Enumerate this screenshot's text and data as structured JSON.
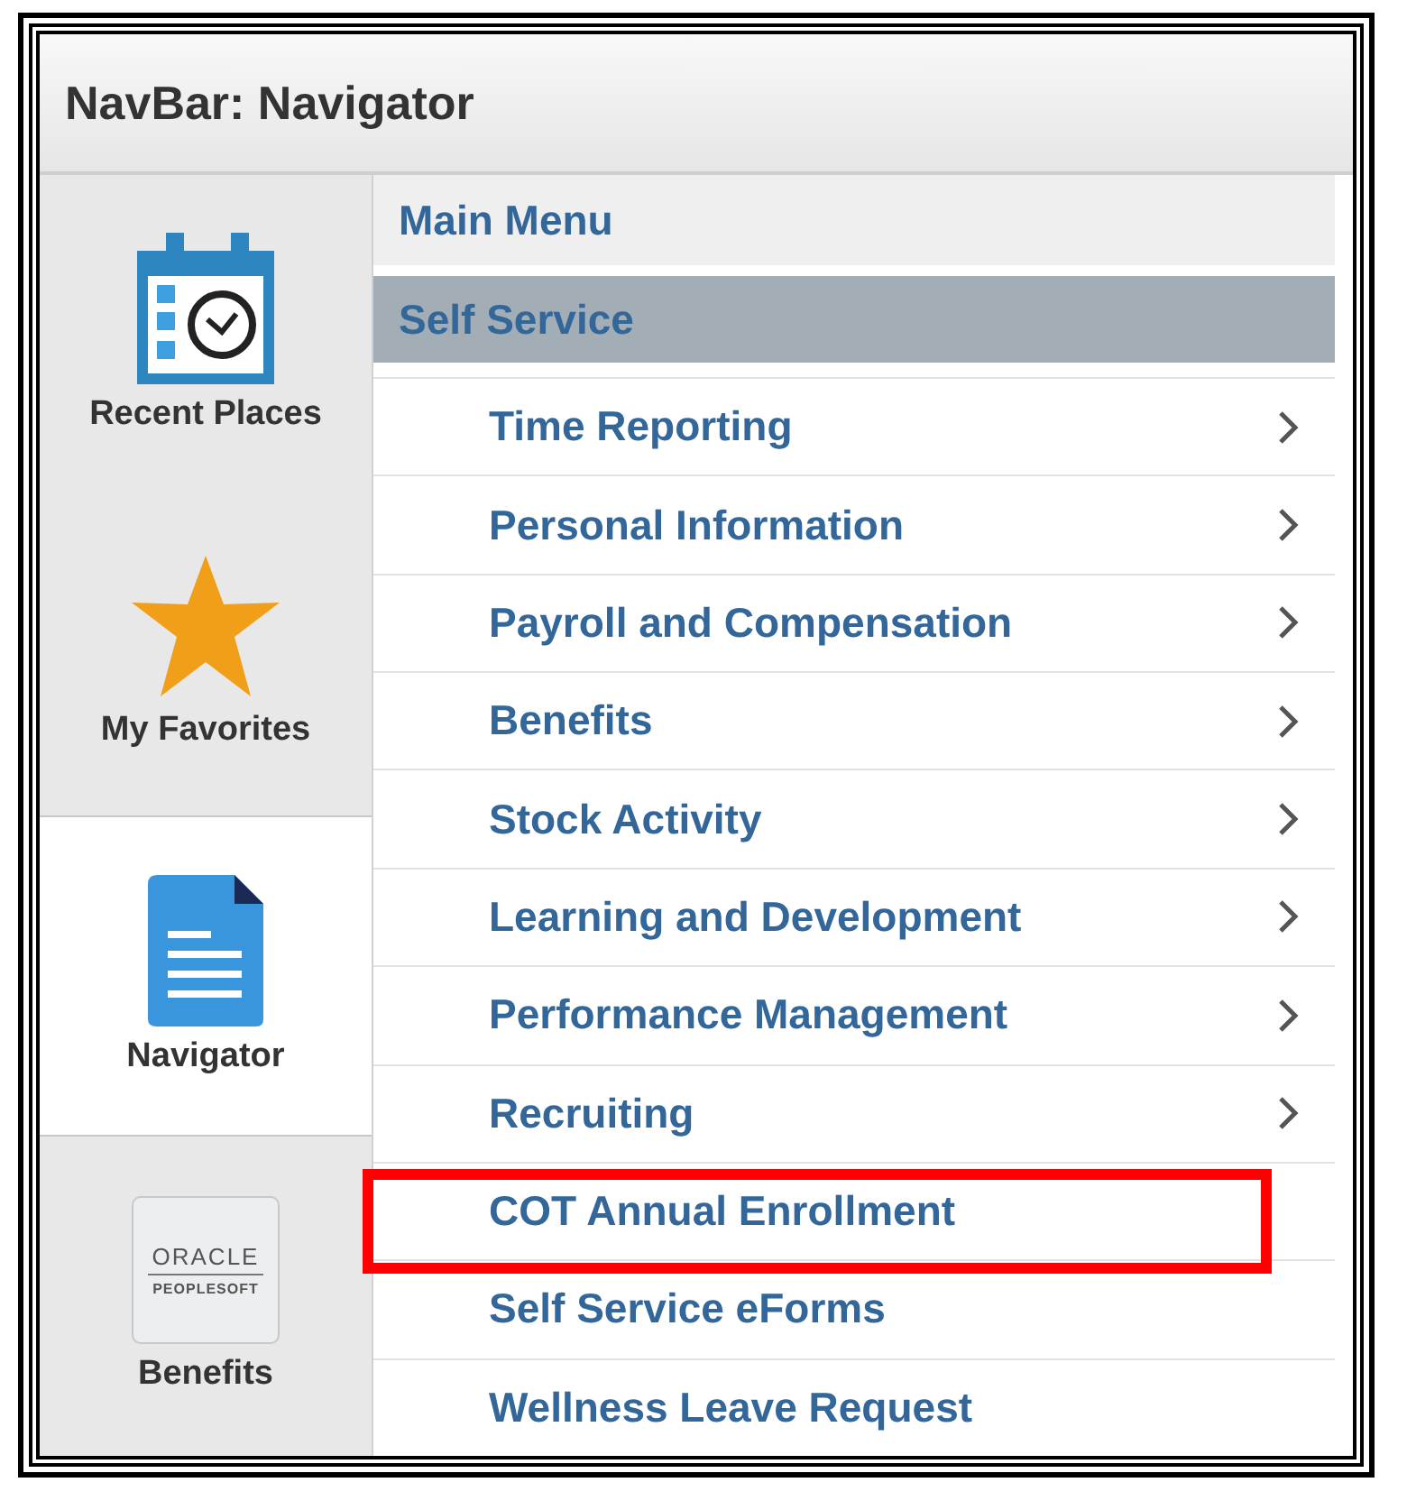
{
  "window": {
    "title": "NavBar: Navigator"
  },
  "sidebar": {
    "items": [
      {
        "kind": "recent",
        "label": "Recent Places",
        "selected": false
      },
      {
        "kind": "favorites",
        "label": "My Favorites",
        "selected": false
      },
      {
        "kind": "navigator",
        "label": "Navigator",
        "selected": true
      },
      {
        "kind": "tile",
        "label": "Benefits",
        "selected": false,
        "logo": {
          "line1": "ORACLE",
          "line2": "PEOPLESOFT"
        }
      }
    ]
  },
  "menu": {
    "breadcrumbs": [
      {
        "label": "Main Menu",
        "selected": false
      },
      {
        "label": "Self Service",
        "selected": true
      }
    ],
    "items": [
      {
        "label": "Time Reporting",
        "kind": "folder",
        "highlighted": false
      },
      {
        "label": "Personal Information",
        "kind": "folder",
        "highlighted": false
      },
      {
        "label": "Payroll and Compensation",
        "kind": "folder",
        "highlighted": false
      },
      {
        "label": "Benefits",
        "kind": "folder",
        "highlighted": false
      },
      {
        "label": "Stock Activity",
        "kind": "folder",
        "highlighted": false
      },
      {
        "label": "Learning and Development",
        "kind": "folder",
        "highlighted": false
      },
      {
        "label": "Performance Management",
        "kind": "folder",
        "highlighted": false
      },
      {
        "label": "Recruiting",
        "kind": "folder",
        "highlighted": false
      },
      {
        "label": "COT Annual Enrollment",
        "kind": "link",
        "highlighted": true
      },
      {
        "label": "Self Service eForms",
        "kind": "link",
        "highlighted": false
      },
      {
        "label": "Wellness Leave Request",
        "kind": "link",
        "highlighted": false
      }
    ]
  }
}
